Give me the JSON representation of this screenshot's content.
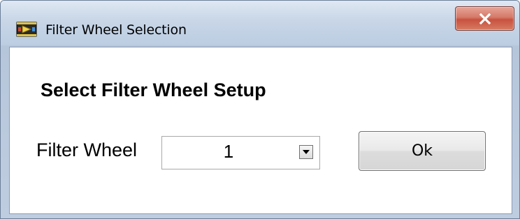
{
  "window": {
    "title": "Filter Wheel Selection",
    "icon": "labview-app-icon",
    "close_icon": "close-icon",
    "close_button_color": "#c7513f"
  },
  "dialog": {
    "heading": "Select Filter Wheel Setup",
    "filter_wheel": {
      "label": "Filter Wheel",
      "selected_value": "1",
      "dropdown_icon": "chevron-down-icon"
    },
    "ok_button_label": "Ok"
  }
}
